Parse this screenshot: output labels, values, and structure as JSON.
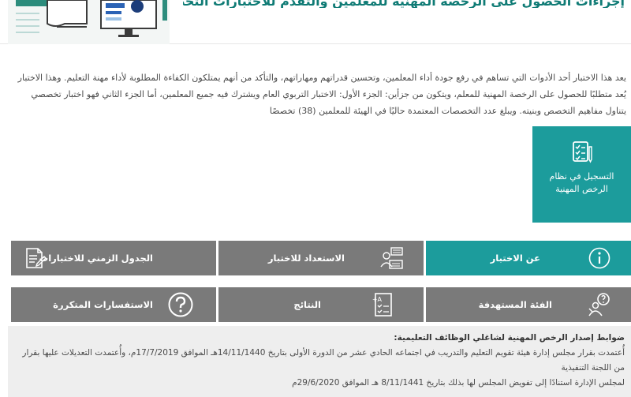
{
  "banner": {
    "title": "إجراءات الحصول على الرخصة المهنية للمعلمين والتقدم للاختبارات التخصصية"
  },
  "intro": {
    "text": "يعد هذا الاختبار أحد الأدوات التي تساهم في رفع جودة أداء المعلمين، وتحسين قدراتهم ومهاراتهم، والتأكد من أنهم يمتلكون الكفاءة المطلوبة لأداء مهنة التعليم. وهذا الاختبار يُعد متطلبًا للحصول على الرخصة المهنية للمعلم، ويتكون من جزأين: الجزء الأول: الاختبار التربوي العام ويشترك فيه جميع المعلمين، أما الجزء الثاني فهو اختبار تخصصي يتناول مفاهيم التخصص وبنيته. ويبلغ عدد التخصصات المعتمدة حاليًا في الهيئة للمعلمين (38) تخصصًا"
  },
  "register": {
    "label": "التسجيل في نظام الرخص المهنية",
    "icon": "checklist-pencil-icon"
  },
  "tiles": {
    "about": {
      "label": "عن الاختبار",
      "icon": "info-icon"
    },
    "prep": {
      "label": "الاستعداد للاختبار",
      "icon": "study-desk-icon"
    },
    "schedule": {
      "label": "الجدول الزمني للاختبارات",
      "icon": "document-pen-icon"
    },
    "audience": {
      "label": "الفئة المستهدفة",
      "icon": "target-audience-icon"
    },
    "results": {
      "label": "النتائج",
      "icon": "graded-paper-icon"
    },
    "faq": {
      "label": "الاستفسارات المتكررة",
      "icon": "question-icon"
    }
  },
  "info": {
    "title": "ضوابط إصدار الرخص المهنية لشاغلي الوظائف التعليمية:",
    "line1": "أُعتمدت بقرار مجلس إدارة هيئة تقويم التعليم والتدريب في اجتماعه الحادي عشر من الدورة الأولى بتاريخ 14/11/1440هـ الموافق 17/7/2019م، وأُعتمدت التعديلات عليها بقرار من اللجنة التنفيذية",
    "line2": "لمجلس الإدارة استنادًا إلى تفويض المجلس لها بذلك بتاريخ 8/11/1441 هـ الموافق 29/6/2020م"
  },
  "colors": {
    "teal": "#1c9c9c",
    "tile_gray": "#7a7a7a",
    "info_bg": "#eeeeee"
  }
}
